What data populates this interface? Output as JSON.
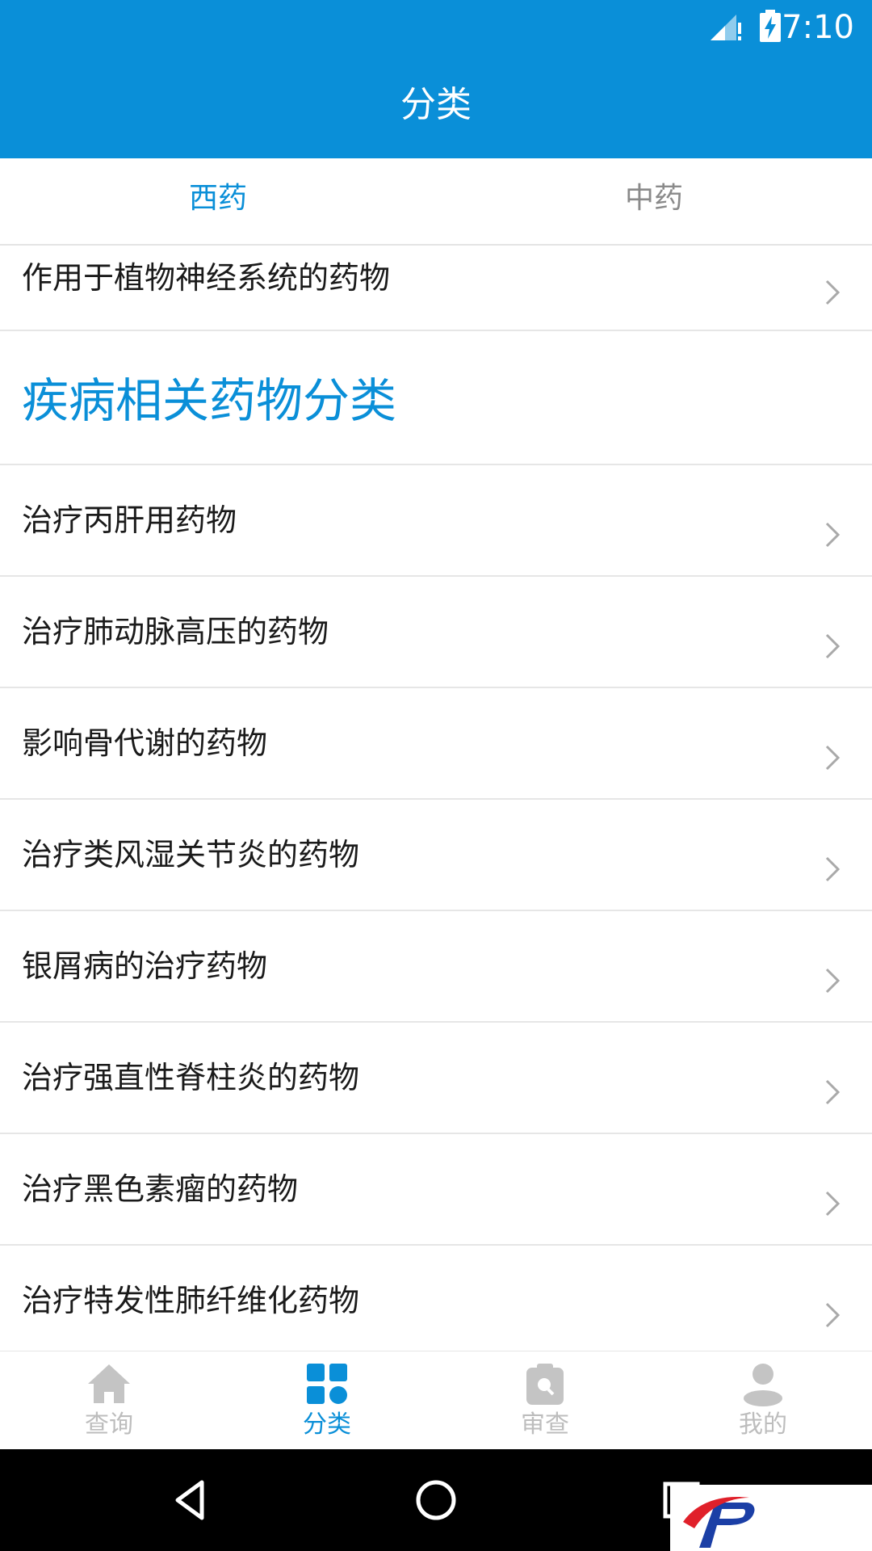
{
  "status_bar": {
    "time": "7:10",
    "signal_icon": "signal-alert-icon",
    "battery_icon": "battery-charging-icon"
  },
  "header": {
    "title": "分类"
  },
  "tabs": [
    {
      "label": "西药",
      "active": true
    },
    {
      "label": "中药",
      "active": false
    }
  ],
  "list": {
    "partial_item": "作用于植物神经系统的药物",
    "section_title": "疾病相关药物分类",
    "items": [
      "治疗丙肝用药物",
      "治疗肺动脉高压的药物",
      "影响骨代谢的药物",
      "治疗类风湿关节炎的药物",
      "银屑病的治疗药物",
      "治疗强直性脊柱炎的药物",
      "治疗黑色素瘤的药物",
      "治疗特发性肺纤维化药物"
    ]
  },
  "bottom_nav": [
    {
      "label": "查询",
      "icon": "home-icon",
      "active": false
    },
    {
      "label": "分类",
      "icon": "grid-icon",
      "active": true
    },
    {
      "label": "审查",
      "icon": "clipboard-icon",
      "active": false
    },
    {
      "label": "我的",
      "icon": "user-icon",
      "active": false
    }
  ],
  "colors": {
    "primary": "#0a8fd8",
    "inactive": "#bdbdbd",
    "text": "#1a1a1a",
    "divider": "#e6e6e6"
  }
}
